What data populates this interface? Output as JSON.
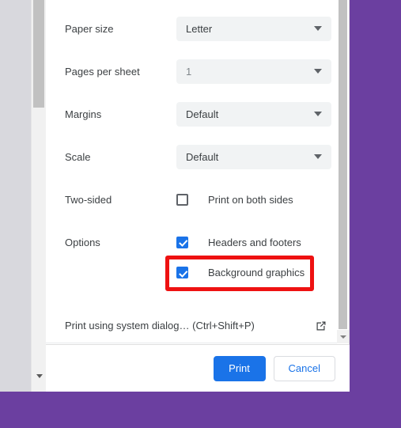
{
  "dialog": {
    "settings_rows": [
      {
        "label": "Paper size",
        "value": "Letter",
        "type": "select",
        "disabled": false
      },
      {
        "label": "Pages per sheet",
        "value": "1",
        "type": "select",
        "disabled": true
      },
      {
        "label": "Margins",
        "value": "Default",
        "type": "select",
        "disabled": false
      },
      {
        "label": "Scale",
        "value": "Default",
        "type": "select",
        "disabled": false
      }
    ],
    "checkbox_rows": [
      {
        "label": "Two-sided",
        "option_label": "Print on both sides",
        "checked": false
      },
      {
        "label": "Options",
        "option_label": "Headers and footers",
        "checked": true
      },
      {
        "label": "",
        "option_label": "Background graphics",
        "checked": true
      }
    ],
    "system_dialog": {
      "label": "Print using system dialog… (Ctrl+Shift+P)",
      "icon": "open-in-new-icon"
    },
    "footer": {
      "print_label": "Print",
      "cancel_label": "Cancel"
    }
  },
  "annotation": {
    "target": "Background graphics",
    "color": "#ee1111"
  },
  "colors": {
    "accent_blue": "#1a73e8",
    "page_background": "#6b3fa0",
    "select_background": "#f1f3f4",
    "text": "#3c4043"
  },
  "icons": {
    "caret": "chevron-down-icon",
    "scroll_down": "scroll-down-arrow-icon"
  }
}
